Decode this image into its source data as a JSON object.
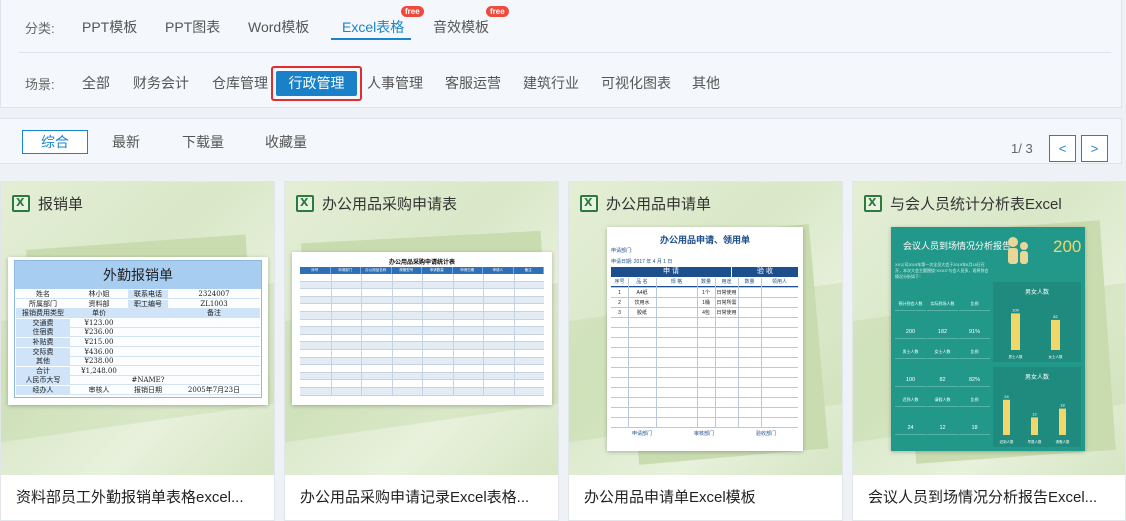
{
  "category_row": {
    "label": "分类:",
    "tabs": [
      {
        "label": "PPT模板",
        "badge": ""
      },
      {
        "label": "PPT图表",
        "badge": ""
      },
      {
        "label": "Word模板",
        "badge": ""
      },
      {
        "label": "Excel表格",
        "badge": "free",
        "active": true
      },
      {
        "label": "音效模板",
        "badge": "free"
      }
    ]
  },
  "scene_row": {
    "label": "场景:",
    "tabs": [
      {
        "label": "全部"
      },
      {
        "label": "财务会计"
      },
      {
        "label": "仓库管理"
      },
      {
        "label": "行政管理",
        "active": true
      },
      {
        "label": "人事管理"
      },
      {
        "label": "客服运营"
      },
      {
        "label": "建筑行业"
      },
      {
        "label": "可视化图表"
      },
      {
        "label": "其他"
      }
    ]
  },
  "sort_bar": {
    "options": [
      "综合",
      "最新",
      "下载量",
      "收藏量"
    ],
    "page_indicator": "1/ 3",
    "prev": "<",
    "next": ">"
  },
  "cards": [
    {
      "title": "报销单",
      "caption": "资料部员工外勤报销单表格excel...",
      "preview": {
        "heading": "外勤报销单",
        "rows": [
          [
            "姓名",
            "林小姐",
            "联系电话",
            "2324007"
          ],
          [
            "所属部门",
            "资料部",
            "职工编号",
            "ZL1003"
          ],
          [
            "报销费用类型",
            "单价",
            "",
            "备注"
          ],
          [
            "交通费",
            "¥123.00",
            "",
            ""
          ],
          [
            "住宿费",
            "¥236.00",
            "",
            ""
          ],
          [
            "补贴费",
            "¥215.00",
            "",
            ""
          ],
          [
            "交际费",
            "¥436.00",
            "",
            ""
          ],
          [
            "其他",
            "¥238.00",
            "",
            ""
          ],
          [
            "合计",
            "¥1,248.00",
            "",
            ""
          ],
          [
            "人民币大写",
            "",
            "#NAME?",
            ""
          ],
          [
            "经办人",
            "审核人",
            "报销日期",
            "2005年7月23日"
          ]
        ]
      }
    },
    {
      "title": "办公用品采购申请表",
      "caption": "办公用品采购申请记录Excel表格...",
      "preview": {
        "heading": "办公用品采购申请统计表",
        "columns": [
          "序号",
          "申请部门",
          "办公用品名称",
          "规格型号",
          "申请数量",
          "申请日期",
          "申请人",
          "备注"
        ]
      }
    },
    {
      "title": "办公用品申请单",
      "caption": "办公用品申请单Excel模板",
      "preview": {
        "heading": "办公用品申请、领用单",
        "dept_label": "申请部门:",
        "date_label": "申请日期:  2017 年 4 月 1 日",
        "section_apply": "申    请",
        "section_check": "验    收",
        "columns": [
          "序号",
          "品 名",
          "规 格",
          "数量",
          "用途",
          "数量",
          "领用人"
        ],
        "rows": [
          [
            "1",
            "A4纸",
            "",
            "1个",
            "日常使用",
            "",
            ""
          ],
          [
            "2",
            "饮用水",
            "",
            "1桶",
            "日常所需",
            "",
            ""
          ],
          [
            "3",
            "胶纸",
            "",
            "4包",
            "日常使用",
            "",
            ""
          ]
        ],
        "footer": [
          "申请部门",
          "审核部门",
          "验收部门"
        ]
      }
    },
    {
      "title": "与会人员统计分析表Excel",
      "caption": "会议人员到场情况分析报告Excel...",
      "preview": {
        "heading": "会议人员到场情况分析报告",
        "big_number": "200",
        "intro": "XX公司2019年第一次全员大会于2019年6月18日召开，本次大会主题围绕“XXXX”与会人员多，现将到会情况分析如下：",
        "stats": [
          [
            "预计到会人数",
            "实际到场人数",
            "比例"
          ],
          [
            "200",
            "182",
            "91%"
          ],
          [
            "男士人数",
            "女士人数",
            "比例"
          ],
          [
            "100",
            "82",
            "82%"
          ],
          [
            "迟到人数",
            "请假人数",
            "比例"
          ],
          [
            "24",
            "12",
            "18"
          ]
        ],
        "chart1_label": "男女人数",
        "chart1_values": [
          100,
          82
        ],
        "chart1_categories": [
          "男士人数",
          "女士人数"
        ],
        "chart2_label": "男女人数",
        "chart2_values": [
          24,
          12,
          18
        ],
        "chart2_categories": [
          "迟到人数",
          "早退人数",
          "请假人数"
        ]
      }
    }
  ]
}
